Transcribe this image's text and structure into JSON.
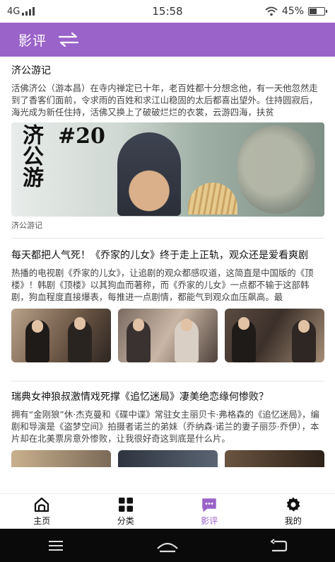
{
  "status_bar": {
    "network": "4G",
    "time": "15:58",
    "battery": "45%"
  },
  "header": {
    "title": "影评",
    "switch_icon": "swap-arrows-icon"
  },
  "articles": [
    {
      "title": "济公游记",
      "body": "活佛济公（游本昌）在寺内禅定已十年，老百姓都十分想念他，有一天他忽然走到了香客们面前，令求雨的百姓和求江山稳固的太后都喜出望外。住持圆寂后，海光成为新任住持，活佛又换上了破破烂烂的衣裳，云游四海，扶贫",
      "image_text": "济公游",
      "image_episode": "#20",
      "caption": "济公游记"
    },
    {
      "title": "每天都把人气死！《乔家的儿女》终于走上正轨，观众还是爱看爽剧",
      "body": "热播的电视剧《乔家的儿女》，让追剧的观众都感叹道，这简直是中国版的《顶楼》！韩剧《顶楼》以其狗血而著称，而《乔家的儿女》一点都不输于这部韩剧，狗血程度直接爆表，每推进一点剧情，都能气到观众血压飙高。最"
    },
    {
      "title": "瑞典女神狼叔激情戏死撑《追忆迷局》凄美绝恋缘何惨败？",
      "body": "拥有“金刚狼”休·杰克曼和《碟中谍》常驻女主丽贝卡·弗格森的《追忆迷局》，编剧和导演是《盗梦空间》拍摄者诺兰的弟妹（乔纳森·诺兰的妻子丽莎·乔伊），本片却在北美票房意外惨败，让我很好奇这到底是什么片。"
    }
  ],
  "tabbar": {
    "items": [
      {
        "label": "主页",
        "icon": "home-icon"
      },
      {
        "label": "分类",
        "icon": "grid-icon"
      },
      {
        "label": "影评",
        "icon": "chat-bubble-icon"
      },
      {
        "label": "我的",
        "icon": "gear-icon"
      }
    ],
    "active": "影评"
  },
  "colors": {
    "accent": "#9a63c9",
    "nav_bar": "#0a0a0a"
  }
}
